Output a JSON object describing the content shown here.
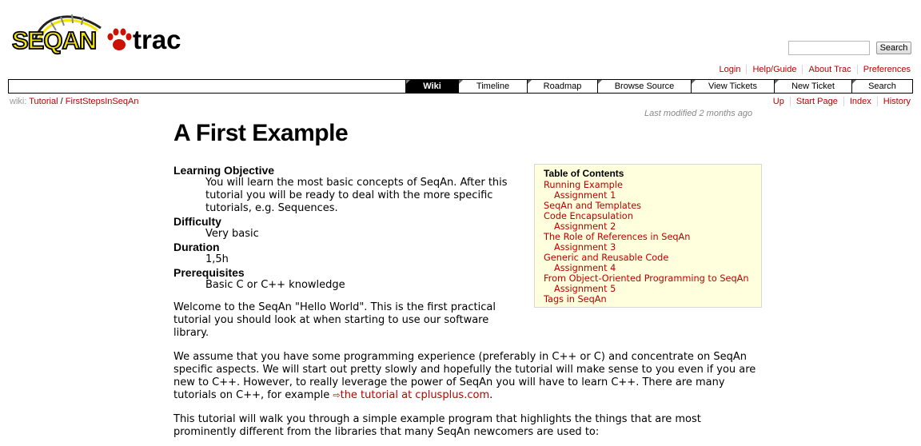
{
  "header": {
    "logo_text": "SEQAN",
    "logo_product": "trac",
    "search_placeholder": "",
    "search_button": "Search"
  },
  "metanav": [
    "Login",
    "Help/Guide",
    "About Trac",
    "Preferences"
  ],
  "mainnav": [
    {
      "label": "Wiki",
      "active": true
    },
    {
      "label": "Timeline",
      "active": false
    },
    {
      "label": "Roadmap",
      "active": false
    },
    {
      "label": "Browse Source",
      "active": false
    },
    {
      "label": "View Tickets",
      "active": false
    },
    {
      "label": "New Ticket",
      "active": false
    },
    {
      "label": "Search",
      "active": false
    }
  ],
  "breadcrumb": {
    "prefix": "wiki:",
    "items": [
      "Tutorial",
      "FirstStepsInSeqAn"
    ],
    "separator": "/"
  },
  "ctxnav": [
    "Up",
    "Start Page",
    "Index",
    "History"
  ],
  "last_modified": {
    "prefix": "Last modified",
    "link": "2 months ago"
  },
  "page": {
    "title": "A First Example",
    "definitions": [
      {
        "term": "Learning Objective",
        "desc": "You will learn the most basic concepts of SeqAn. After this tutorial you will be ready to deal with the more specific tutorials, e.g. Sequences."
      },
      {
        "term": "Difficulty",
        "desc": "Very basic"
      },
      {
        "term": "Duration",
        "desc": "1,5h"
      },
      {
        "term": "Prerequisites",
        "desc": "Basic C or C++ knowledge"
      }
    ],
    "welcome": "Welcome to the SeqAn \"Hello World\". This is the first practical tutorial you should look at when starting to use our software library.",
    "assume_text": "We assume that you have some programming experience (preferably in C++ or C) and concentrate on SeqAn specific aspects. We will start out pretty slowly and hopefully the tutorial will make sense to you even if you are new to C++. However, to really leverage the power of SeqAn you will have to learn C++. There are many tutorials on C++, for example ",
    "assume_link": "the tutorial at cplusplus.com",
    "assume_end": ".",
    "walk_text": "This tutorial will walk you through a simple example program that highlights the things that are most prominently different from the libraries that many SeqAn newcomers are used to:"
  },
  "toc": {
    "title": "Table of Contents",
    "items": [
      {
        "label": "Running Example",
        "level": 1
      },
      {
        "label": "Assignment 1",
        "level": 2
      },
      {
        "label": "SeqAn and Templates",
        "level": 1
      },
      {
        "label": "Code Encapsulation",
        "level": 1
      },
      {
        "label": "Assignment 2",
        "level": 2
      },
      {
        "label": "The Role of References in SeqAn",
        "level": 1
      },
      {
        "label": "Assignment 3",
        "level": 2
      },
      {
        "label": "Generic and Reusable Code",
        "level": 1
      },
      {
        "label": "Assignment 4",
        "level": 2
      },
      {
        "label": "From Object-Oriented Programming to SeqAn",
        "level": 1
      },
      {
        "label": "Assignment 5",
        "level": 2
      },
      {
        "label": "Tags in SeqAn",
        "level": 1
      }
    ]
  },
  "colors": {
    "link": "#bb0000",
    "logo_yellow": "#f2e600",
    "logo_red": "#cc1100",
    "toc_bg": "#ffffdd"
  }
}
